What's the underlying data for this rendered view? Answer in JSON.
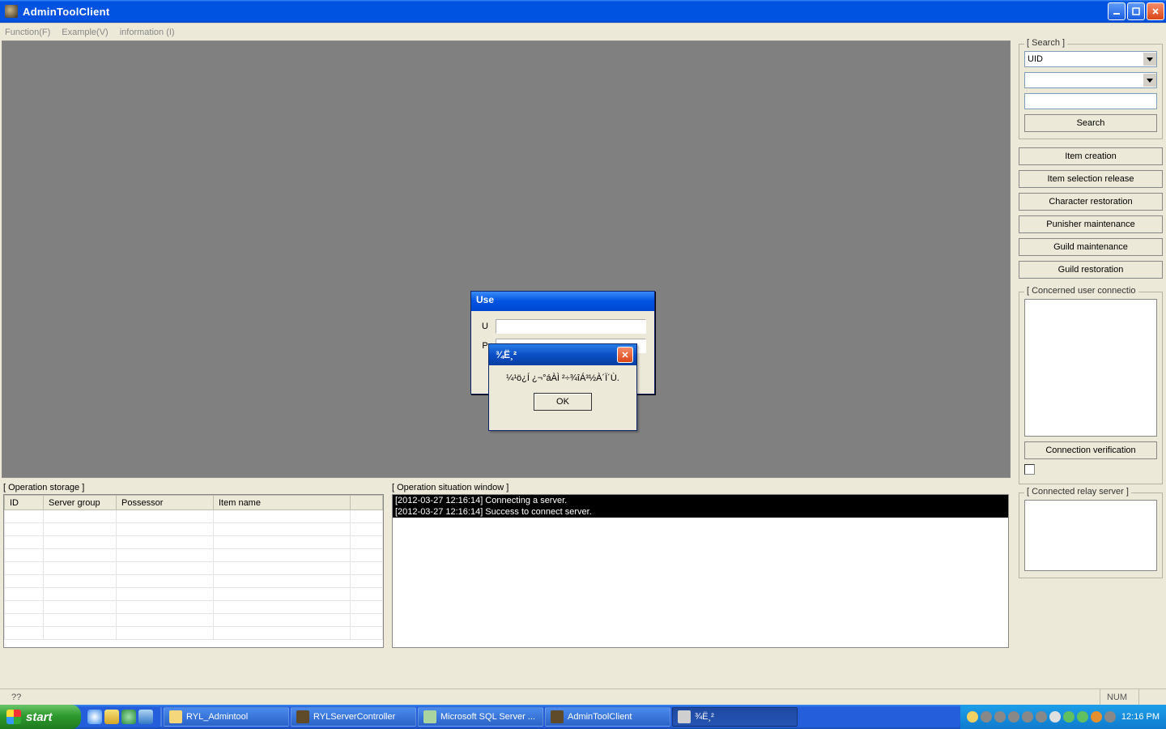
{
  "window": {
    "title": "AdminToolClient"
  },
  "menu": {
    "items": [
      "Function(F)",
      "Example(V)",
      "information (I)"
    ]
  },
  "sidebar": {
    "search": {
      "legend": "[ Search ]",
      "type_value": "UID",
      "sub_value": "",
      "text_value": "",
      "button": "Search"
    },
    "actions": [
      "Item creation",
      "Item selection release",
      "Character restoration",
      "Punisher maintenance",
      "Guild maintenance",
      "Guild restoration"
    ],
    "concerned": {
      "legend": "[ Concerned user connectio",
      "verify_button": "Connection verification"
    },
    "relay": {
      "legend": "[ Connected relay server ]"
    }
  },
  "op_storage": {
    "legend": "[ Operation storage ]",
    "columns": [
      "ID",
      "Server group",
      "Possessor",
      "Item name",
      ""
    ]
  },
  "op_situation": {
    "legend": "[ Operation situation window ]",
    "log_lines": [
      "[2012-03-27 12:16:14] Connecting a server.",
      "[2012-03-27 12:16:14] Success to connect server."
    ]
  },
  "login_dialog": {
    "title": "Use",
    "user_label": "U",
    "pass_label": "P"
  },
  "popup": {
    "title": "¾Ë¸²",
    "message": "¼­¹ö¿Í ¿¬°áÀÌ ²÷¾îÁ³½À´Ï´Ù.",
    "ok": "OK"
  },
  "statusbar": {
    "hint": "??",
    "num": "NUM"
  },
  "taskbar": {
    "start": "start",
    "items": [
      {
        "label": "RYL_Admintool",
        "icon_color": "#f4d77a",
        "active": false
      },
      {
        "label": "RYLServerController",
        "icon_color": "#5f4a2a",
        "active": false
      },
      {
        "label": "Microsoft SQL Server ...",
        "icon_color": "#a9d4a0",
        "active": false
      },
      {
        "label": "AdminToolClient",
        "icon_color": "#5f4a2a",
        "active": false
      },
      {
        "label": "¾Ë¸²",
        "icon_color": "#cfcfcf",
        "active": true
      }
    ],
    "tray_time": "12:16 PM"
  }
}
